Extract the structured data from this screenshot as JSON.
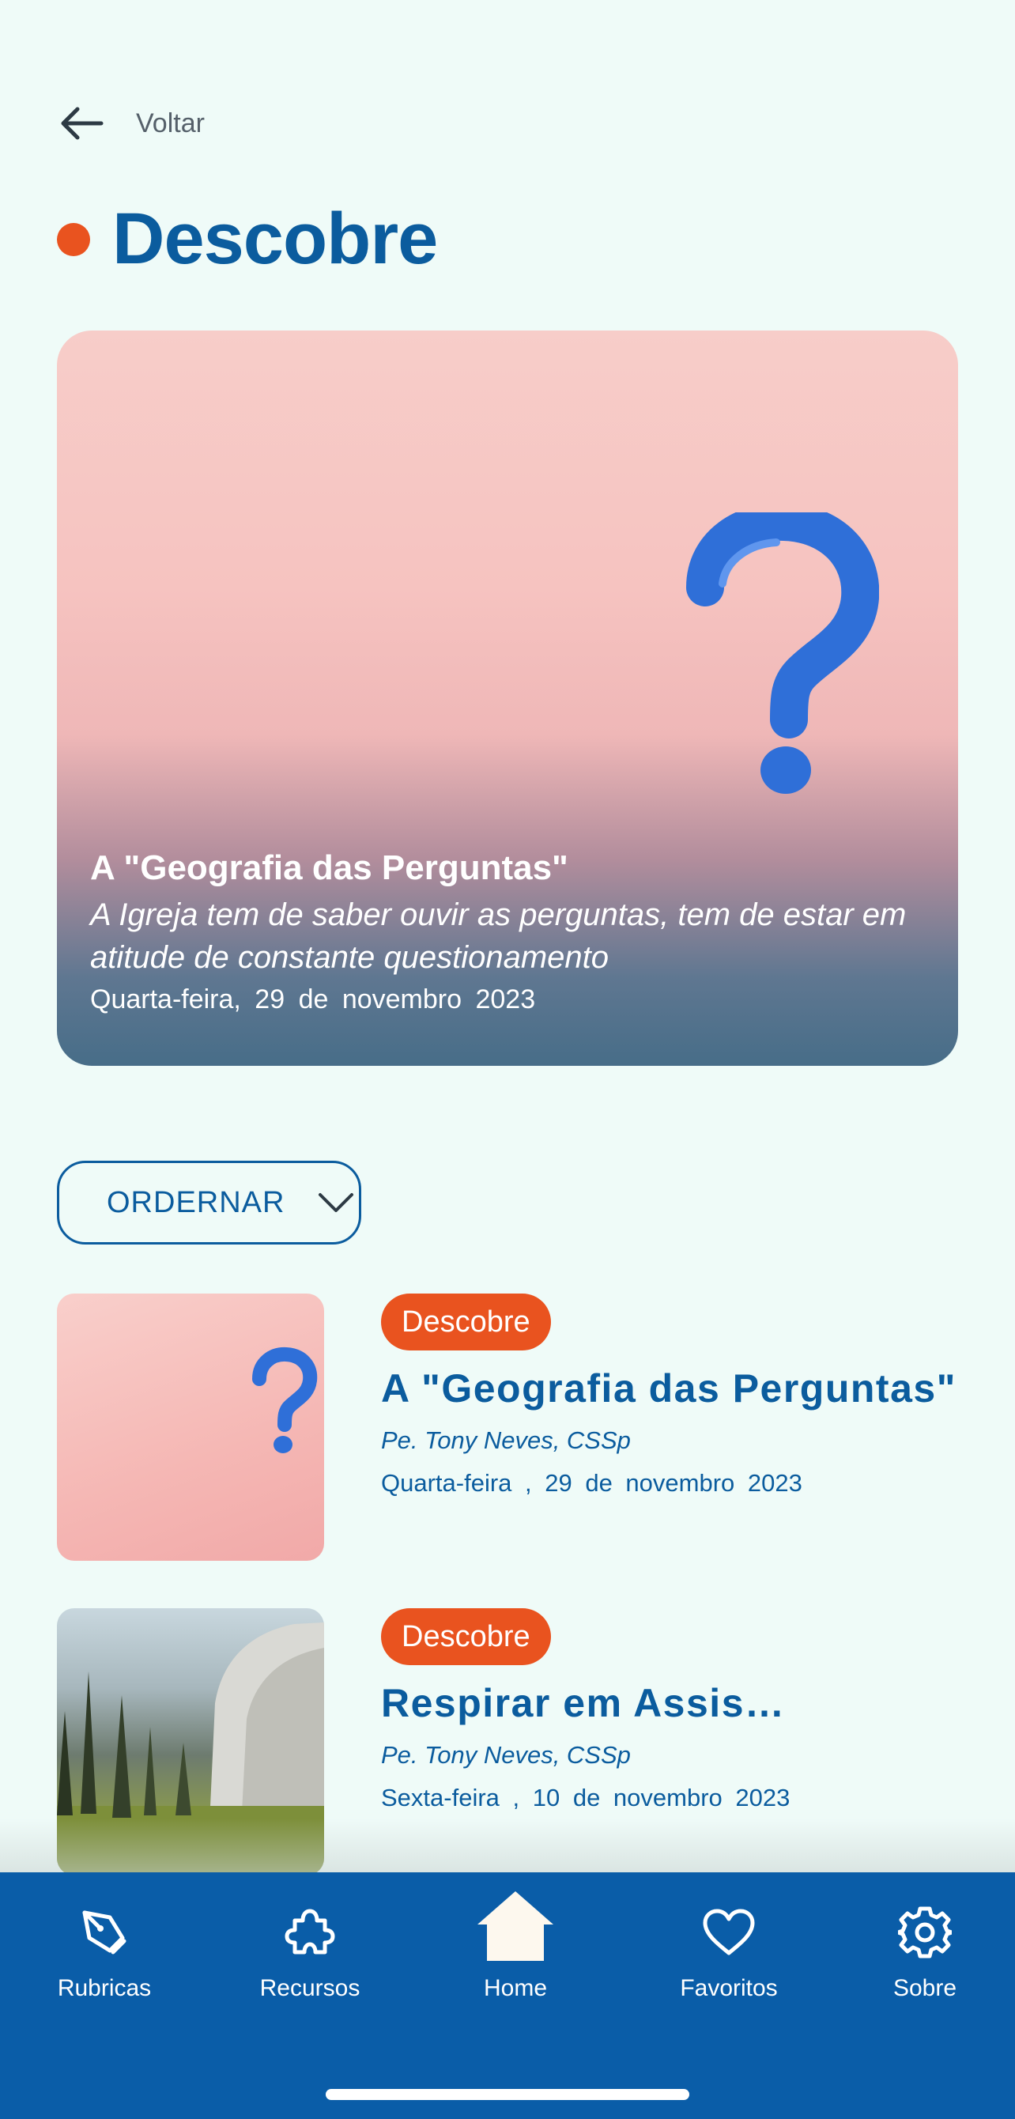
{
  "header": {
    "back_label": "Voltar",
    "title": "Descobre"
  },
  "accent_colors": {
    "brand_blue": "#0b5c9e",
    "accent_orange": "#e9531f",
    "nav_blue": "#0a5da8",
    "background": "#effbf8"
  },
  "hero": {
    "title": "A \"Geografia das Perguntas\"",
    "subtitle": "A Igreja tem de saber ouvir as perguntas, tem de estar em atitude de constante questionamento",
    "date": "Quarta-feira, 29 de novembro 2023",
    "image_icon": "question-mark-image"
  },
  "sort": {
    "label": "ORDERNAR",
    "icon": "chevron-down-icon"
  },
  "articles": [
    {
      "badge": "Descobre",
      "title": "A \"Geografia das Perguntas\"",
      "author": "Pe. Tony Neves, CSSp",
      "date": "Quarta-feira , 29 de novembro 2023",
      "image_icon": "question-mark-image"
    },
    {
      "badge": "Descobre",
      "title": "Respirar em Assis…",
      "author": "Pe. Tony Neves, CSSp",
      "date": "Sexta-feira , 10 de novembro 2023",
      "image_icon": "landscape-image"
    }
  ],
  "bottom_nav": [
    {
      "label": "Rubricas",
      "icon": "pen-tool-icon"
    },
    {
      "label": "Recursos",
      "icon": "puzzle-icon"
    },
    {
      "label": "Home",
      "icon": "home-icon",
      "active": true
    },
    {
      "label": "Favoritos",
      "icon": "heart-icon"
    },
    {
      "label": "Sobre",
      "icon": "gear-icon"
    }
  ]
}
